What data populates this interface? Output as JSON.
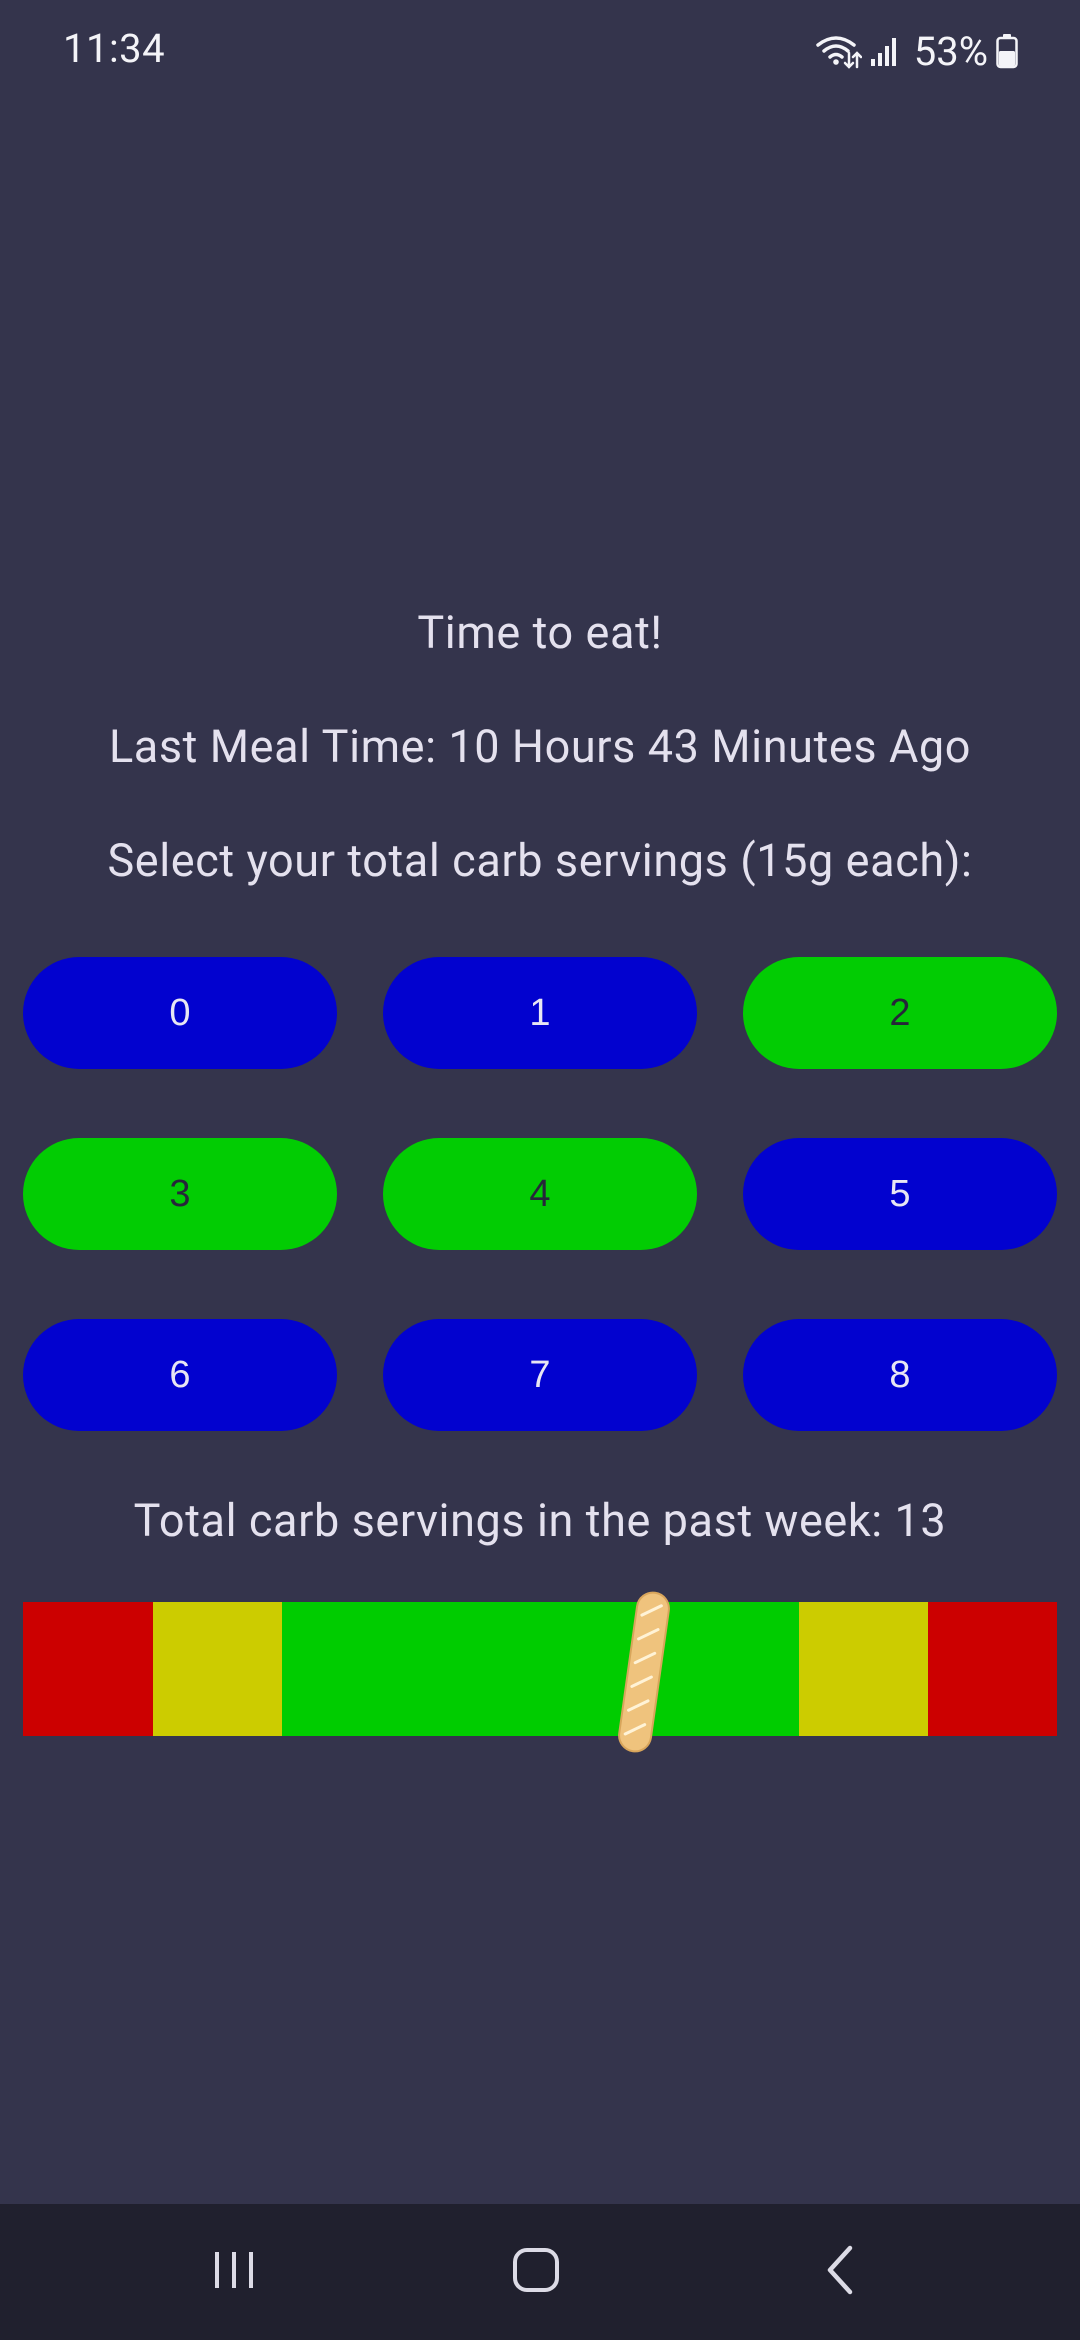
{
  "status_bar": {
    "time": "11:34",
    "battery_percent": "53%",
    "icons": [
      "wifi-data-icon",
      "cellular-signal-icon",
      "battery-icon"
    ]
  },
  "main": {
    "headline": "Time to eat!",
    "last_meal": "Last Meal Time: 10 Hours 43 Minutes Ago",
    "prompt": "Select your total carb servings (15g each):",
    "buttons": [
      {
        "label": "0",
        "color": "blue"
      },
      {
        "label": "1",
        "color": "blue"
      },
      {
        "label": "2",
        "color": "green"
      },
      {
        "label": "3",
        "color": "green"
      },
      {
        "label": "4",
        "color": "green"
      },
      {
        "label": "5",
        "color": "blue"
      },
      {
        "label": "6",
        "color": "blue"
      },
      {
        "label": "7",
        "color": "blue"
      },
      {
        "label": "8",
        "color": "blue"
      }
    ],
    "weekly_total": "Total carb servings in the past week: 13",
    "gauge": {
      "segments": [
        "red",
        "yellow",
        "green",
        "green",
        "yellow",
        "red"
      ],
      "marker_icon": "baguette-icon",
      "marker_level": 0.6
    }
  },
  "colors": {
    "background": "#34344c",
    "button_blue": "#0202cf",
    "button_green": "#02cc03",
    "gauge_red": "#cc0000",
    "gauge_yellow": "#cccc00",
    "gauge_green": "#00cc00",
    "nav_bar": "#20202e"
  },
  "nav_bar": {
    "buttons": [
      "recent-apps-icon",
      "home-icon",
      "back-icon"
    ]
  }
}
